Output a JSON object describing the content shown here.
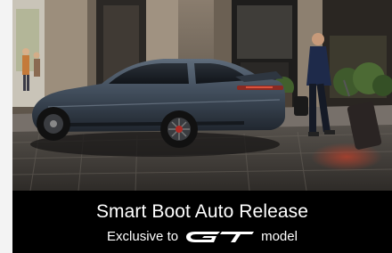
{
  "caption": {
    "title": "Smart Boot Auto Release",
    "subtitle_prefix": "Exclusive to",
    "subtitle_suffix": "model",
    "logo_text": "GT"
  },
  "colors": {
    "caption_background": "#000000",
    "caption_text": "#ffffff",
    "car_body": "#3e4a58"
  },
  "icons": {
    "logo": "gt-logo"
  }
}
